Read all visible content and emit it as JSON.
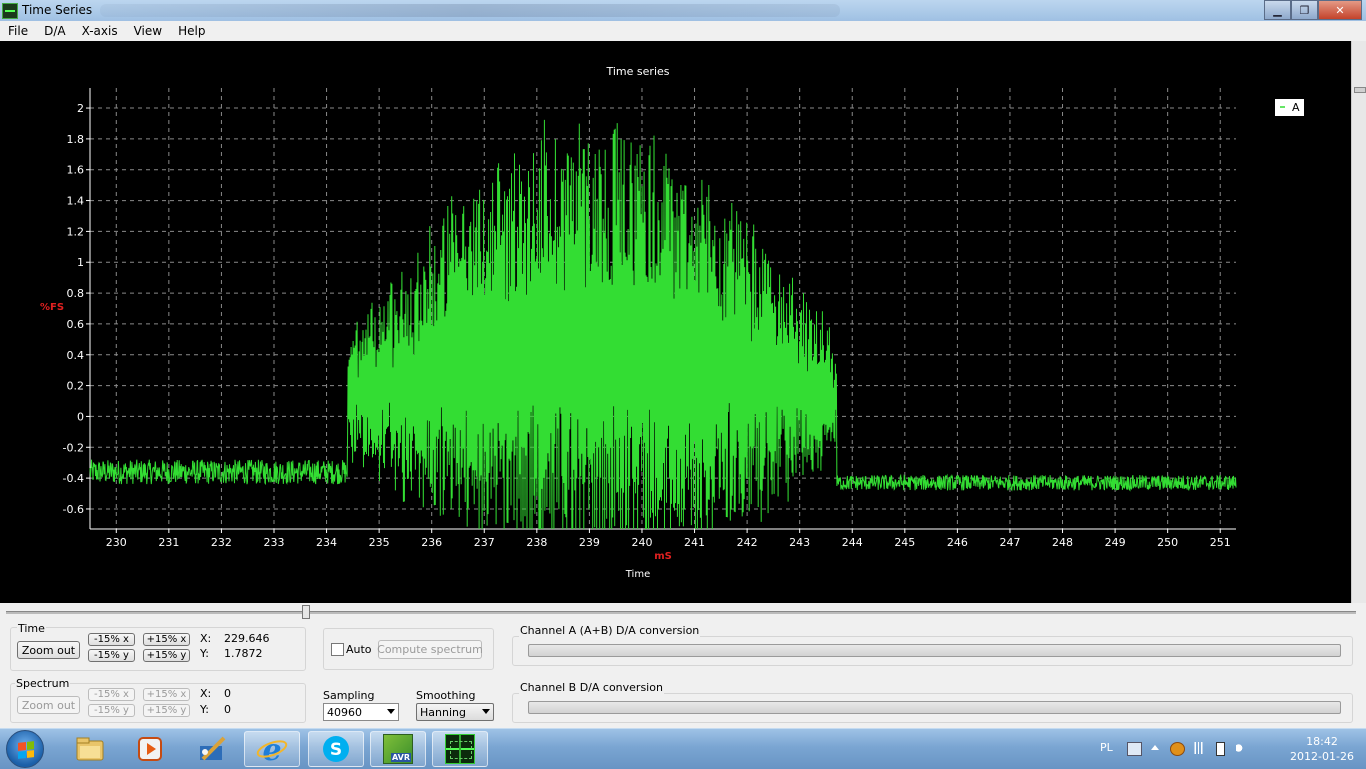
{
  "window": {
    "title": "Time Series",
    "controls": {
      "minimize": "▁",
      "maximize": "❐",
      "close": "✕"
    }
  },
  "menu": [
    "File",
    "D/A",
    "X-axis",
    "View",
    "Help"
  ],
  "chart_data": {
    "type": "line",
    "title": "Time series",
    "xlabel": "Time",
    "x_unit": "mS",
    "ylabel": "%FS",
    "xlim": [
      229.5,
      251.3
    ],
    "ylim": [
      -0.73,
      2.13
    ],
    "x_ticks": [
      230,
      231,
      232,
      233,
      234,
      235,
      236,
      237,
      238,
      239,
      240,
      241,
      242,
      243,
      244,
      245,
      246,
      247,
      248,
      249,
      250,
      251
    ],
    "y_ticks": [
      -0.6,
      -0.4,
      -0.2,
      0,
      0.2,
      0.4,
      0.6,
      0.8,
      1,
      1.2,
      1.4,
      1.6,
      1.8,
      2
    ],
    "grid": true,
    "legend": "top-right",
    "series": [
      {
        "name": "A",
        "color": "#33dd33",
        "baseline_before": {
          "x_range": [
            229.5,
            234.4
          ],
          "mean": -0.36,
          "spread": 0.08
        },
        "burst": {
          "x_range": [
            234.4,
            243.7
          ],
          "peak_x": 239,
          "max": 2.13,
          "min": -0.73
        },
        "baseline_after": {
          "x_range": [
            243.7,
            251.3
          ],
          "mean": -0.43,
          "spread": 0.05
        }
      }
    ]
  },
  "time_group": {
    "label": "Time",
    "zoom_out": "Zoom out",
    "minus_x": "-15% x",
    "plus_x": "+15% x",
    "minus_y": "-15% y",
    "plus_y": "+15% y",
    "x_label": "X:",
    "x_value": "229.646",
    "y_label": "Y:",
    "y_value": "1.7872"
  },
  "spectrum_group": {
    "label": "Spectrum",
    "zoom_out": "Zoom out",
    "minus_x": "-15% x",
    "plus_x": "+15% x",
    "minus_y": "-15% y",
    "plus_y": "+15% y",
    "x_label": "X:",
    "x_value": "0",
    "y_label": "Y:",
    "y_value": "0"
  },
  "spectrum_controls": {
    "auto_label": "Auto",
    "auto_checked": false,
    "compute": "Compute spectrum",
    "sampling_label": "Sampling",
    "sampling_value": "40960",
    "smoothing_label": "Smoothing",
    "smoothing_value": "Hanning"
  },
  "conversion": {
    "channel_a_label": "Channel A (A+B) D/A conversion",
    "channel_a_progress": 0,
    "channel_b_label": "Channel B D/A conversion",
    "channel_b_progress": 0
  },
  "taskbar": {
    "apps": [
      "explorer-icon",
      "media-player-icon",
      "drawing-app-icon",
      "internet-explorer-icon",
      "skype-icon",
      "avr-studio-icon",
      "time-series-app-icon"
    ],
    "avr_text": "AVR",
    "language": "PL",
    "time": "18:42",
    "date": "2012-01-26"
  }
}
